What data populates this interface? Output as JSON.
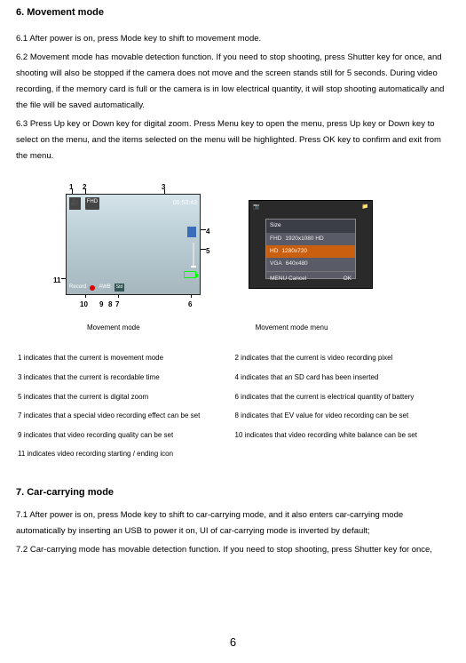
{
  "section6": {
    "title": "6. Movement mode",
    "p1": "6.1 After power is on, press Mode key to shift to movement mode.",
    "p2": "6.2 Movement mode has movable detection function. If you need to stop shooting, press Shutter key for once, and shooting will also be stopped if the camera does not move and the screen stands still for 5 seconds. During video recording, if the memory card is full or the camera is in low electrical quantity, it will stop shooting automatically and the file will be saved automatically.",
    "p3": "6.3 Press Up key or Down key for digital zoom. Press Menu key to open the menu, press Up key or Down key to select on the menu, and the items selected on the menu will be highlighted. Press OK key to confirm and exit from the menu."
  },
  "figure1": {
    "caption": "Movement mode",
    "overlay": {
      "fhd": "FHD",
      "time": "00:53:43",
      "record": "Record",
      "awb": "AWB",
      "std": "Std"
    },
    "nums": {
      "n1": "1",
      "n2": "2",
      "n3": "3",
      "n4": "4",
      "n5": "5",
      "n6": "6",
      "n7": "7",
      "n8": "8",
      "n9": "9",
      "n10": "10",
      "n11": "11"
    }
  },
  "figure2": {
    "caption": "Movement mode menu",
    "top": {
      "cam": "📷",
      "file": "📁"
    },
    "menu": {
      "header": "Size",
      "row1": {
        "badge": "FHD",
        "text": "1920x1080  HD"
      },
      "row2": {
        "badge": "HD",
        "text": "1280x720"
      },
      "row3": {
        "badge": "VGA",
        "text": "640x480"
      },
      "footer_left": "MENU Cancel",
      "footer_right": "OK"
    }
  },
  "indicators": {
    "r1": "1 indicates that the current is movement mode",
    "r2": "2 indicates that the current is video recording pixel",
    "r3": "3 indicates that the current is recordable time",
    "r4": "4 indicates that an SD card has been inserted",
    "r5": "5 indicates that the current is digital zoom",
    "r6": "6 indicates that the current is electrical quantity of battery",
    "r7": "7 indicates that a special video recording effect can be set",
    "r8": "8 indicates that EV value for video recording can be set",
    "r9": "9 indicates that video recording quality can be set",
    "r10": "10 indicates that video recording white balance can be set",
    "r11": "11 indicates video recording starting / ending icon"
  },
  "section7": {
    "title": "7. Car-carrying mode",
    "p1": "7.1 After power is on, press Mode key to shift to car-carrying mode, and it also enters car-carrying mode automatically by inserting an USB to power it on, UI of car-carrying mode is inverted by default;",
    "p2": "7.2 Car-carrying mode has movable detection function. If you need to stop shooting, press Shutter key for once,"
  },
  "pageNumber": "6"
}
